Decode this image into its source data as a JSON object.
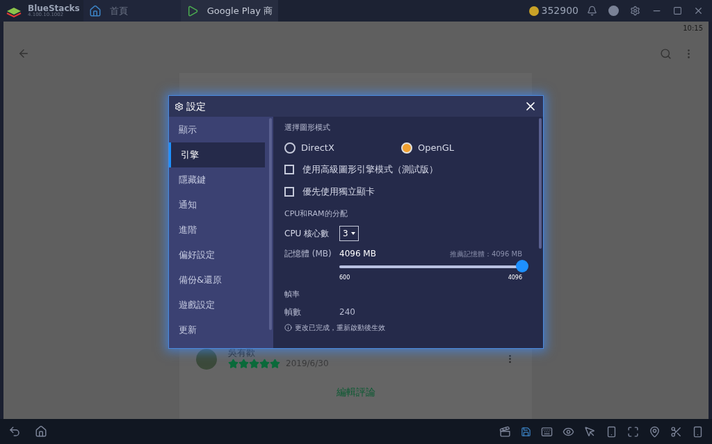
{
  "titlebar": {
    "app_name": "BlueStacks",
    "version": "4.100.10.1002",
    "tabs": [
      {
        "label": "首頁",
        "selected": false
      },
      {
        "label": "Google Play 商",
        "selected": true
      }
    ],
    "coins": "352900"
  },
  "android": {
    "time": "10:15",
    "review": {
      "name": "吳有歡",
      "stars": 5,
      "date": "2019/6/30"
    },
    "edit_link": "編輯評論"
  },
  "dialog": {
    "title": "設定",
    "sidebar": [
      {
        "label": "顯示",
        "selected": false
      },
      {
        "label": "引擎",
        "selected": true
      },
      {
        "label": "隱藏鍵",
        "selected": false
      },
      {
        "label": "通知",
        "selected": false
      },
      {
        "label": "進階",
        "selected": false
      },
      {
        "label": "偏好設定",
        "selected": false
      },
      {
        "label": "備份&還原",
        "selected": false
      },
      {
        "label": "遊戲設定",
        "selected": false
      },
      {
        "label": "更新",
        "selected": false
      }
    ],
    "graphics_heading": "選擇圖形模式",
    "modes": [
      {
        "label": "DirectX",
        "selected": false
      },
      {
        "label": "OpenGL",
        "selected": true
      }
    ],
    "options": [
      {
        "label": "使用高級圖形引擎模式（測試版）",
        "checked": false
      },
      {
        "label": "優先使用獨立顯卡",
        "checked": false
      }
    ],
    "alloc_heading": "CPU和RAM的分配",
    "cpu_label": "CPU 核心數",
    "cpu_value": "3",
    "memory_label": "記憶體 (MB)",
    "memory_value": "4096 MB",
    "memory_recommended": "推薦記憶體：4096 MB",
    "memory_slider": {
      "level": 1
    },
    "memory_min": "600",
    "memory_max": "4096",
    "fps_heading": "幀率",
    "fps_label": "幀數",
    "fps_value": "240",
    "note": "更改已完成，重新啟動後生效"
  }
}
